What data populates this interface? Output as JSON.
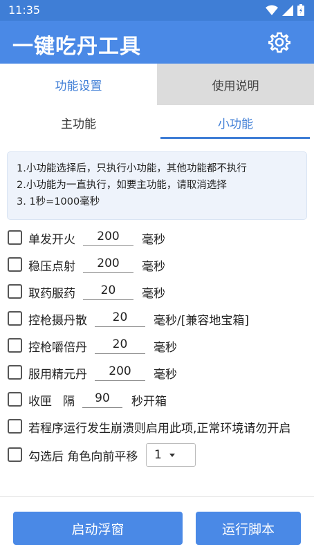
{
  "status": {
    "time": "11:35"
  },
  "app": {
    "title": "一键吃丹工具",
    "icon": "gear-icon"
  },
  "tabs": [
    {
      "label": "功能设置"
    },
    {
      "label": "使用说明"
    }
  ],
  "subtabs": [
    {
      "label": "主功能"
    },
    {
      "label": "小功能"
    }
  ],
  "notice": [
    "1.小功能选择后，只执行小功能，其他功能都不执行",
    "2.小功能为一直执行，如要主功能，请取消选择",
    "3. 1秒=1000毫秒"
  ],
  "options": [
    {
      "label": "单发开火",
      "value": "200",
      "unit": "毫秒"
    },
    {
      "label": "稳压点射",
      "value": "200",
      "unit": "毫秒"
    },
    {
      "label": "取药服药",
      "value": "20",
      "unit": "毫秒"
    },
    {
      "label": "控枪摄丹散",
      "value": "20",
      "unit": "毫秒/[兼容地宝箱]"
    },
    {
      "label": "控枪嚼倍丹",
      "value": "20",
      "unit": "毫秒"
    },
    {
      "label": "服用精元丹",
      "value": "200",
      "unit": "毫秒"
    },
    {
      "label": "收匣",
      "mid": "隔",
      "value": "90",
      "unit": "秒开箱"
    }
  ],
  "crash_option": {
    "label": "若程序运行发生崩溃则启用此项,正常环境请勿开启"
  },
  "move_option": {
    "label": "勾选后 角色向前平移",
    "selected": "1"
  },
  "buttons": {
    "float": "启动浮窗",
    "run": "运行脚本"
  },
  "colors": {
    "primary": "#4a89e6",
    "accent": "#3f7ed6"
  }
}
